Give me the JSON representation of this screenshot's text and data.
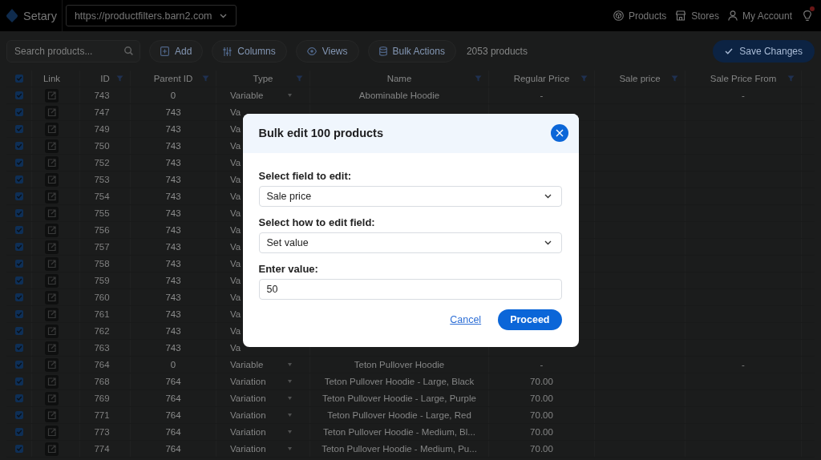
{
  "topbar": {
    "app_name": "Setary",
    "site_selector": "https://productfilters.barn2.com",
    "nav": [
      {
        "kind": "products",
        "label": "Products"
      },
      {
        "kind": "stores",
        "label": "Stores"
      },
      {
        "kind": "account",
        "label": "My Account"
      }
    ],
    "notification_dot": true
  },
  "toolbar": {
    "search": {
      "placeholder": "Search products..."
    },
    "buttons": [
      {
        "kind": "add",
        "label": "Add"
      },
      {
        "kind": "columns",
        "label": "Columns"
      },
      {
        "kind": "views",
        "label": "Views"
      },
      {
        "kind": "bulk",
        "label": "Bulk Actions"
      }
    ],
    "product_count": "2053 products",
    "save_button": "Save Changes"
  },
  "table": {
    "select_all": {
      "checked": true
    },
    "columns": [
      {
        "label": "Link",
        "filter": false
      },
      {
        "label": "ID",
        "filter": true
      },
      {
        "label": "Parent ID",
        "filter": true
      },
      {
        "label": "Type",
        "filter": true
      },
      {
        "label": "Name",
        "filter": true
      },
      {
        "label": "Regular Price",
        "filter": true
      },
      {
        "label": "Sale price",
        "filter": true
      },
      {
        "label": "Sale Price From",
        "filter": true
      }
    ],
    "rows": [
      {
        "checked": true,
        "id": "743",
        "parent_id": "0",
        "type": "Variable",
        "name": "Abominable Hoodie",
        "regular_price": "-",
        "sale_price_from": "-"
      },
      {
        "checked": true,
        "id": "747",
        "parent_id": "743",
        "type": "Va"
      },
      {
        "checked": true,
        "id": "749",
        "parent_id": "743",
        "type": "Va"
      },
      {
        "checked": true,
        "id": "750",
        "parent_id": "743",
        "type": "Va"
      },
      {
        "checked": true,
        "id": "752",
        "parent_id": "743",
        "type": "Va"
      },
      {
        "checked": true,
        "id": "753",
        "parent_id": "743",
        "type": "Va"
      },
      {
        "checked": true,
        "id": "754",
        "parent_id": "743",
        "type": "Va"
      },
      {
        "checked": true,
        "id": "755",
        "parent_id": "743",
        "type": "Va"
      },
      {
        "checked": true,
        "id": "756",
        "parent_id": "743",
        "type": "Va"
      },
      {
        "checked": true,
        "id": "757",
        "parent_id": "743",
        "type": "Va"
      },
      {
        "checked": true,
        "id": "758",
        "parent_id": "743",
        "type": "Va"
      },
      {
        "checked": true,
        "id": "759",
        "parent_id": "743",
        "type": "Va"
      },
      {
        "checked": true,
        "id": "760",
        "parent_id": "743",
        "type": "Va"
      },
      {
        "checked": true,
        "id": "761",
        "parent_id": "743",
        "type": "Va"
      },
      {
        "checked": true,
        "id": "762",
        "parent_id": "743",
        "type": "Va"
      },
      {
        "checked": true,
        "id": "763",
        "parent_id": "743",
        "type": "Va"
      },
      {
        "checked": true,
        "id": "764",
        "parent_id": "0",
        "type": "Variable",
        "name": "Teton Pullover Hoodie",
        "regular_price": "-",
        "sale_price_from": "-"
      },
      {
        "checked": true,
        "id": "768",
        "parent_id": "764",
        "type": "Variation",
        "name": "Teton Pullover Hoodie - Large, Black",
        "regular_price": "70.00"
      },
      {
        "checked": true,
        "id": "769",
        "parent_id": "764",
        "type": "Variation",
        "name": "Teton Pullover Hoodie - Large, Purple",
        "regular_price": "70.00"
      },
      {
        "checked": true,
        "id": "771",
        "parent_id": "764",
        "type": "Variation",
        "name": "Teton Pullover Hoodie - Large, Red",
        "regular_price": "70.00"
      },
      {
        "checked": true,
        "id": "773",
        "parent_id": "764",
        "type": "Variation",
        "name": "Teton Pullover Hoodie - Medium, Bl...",
        "regular_price": "70.00"
      },
      {
        "checked": true,
        "id": "774",
        "parent_id": "764",
        "type": "Variation",
        "name": "Teton Pullover Hoodie - Medium, Pu...",
        "regular_price": "70.00"
      }
    ]
  },
  "modal": {
    "title": "Bulk edit 100 products",
    "fields": [
      {
        "kind": "select",
        "label": "Select field to edit:",
        "value": "Sale price"
      },
      {
        "kind": "select",
        "label": "Select how to edit field:",
        "value": "Set value"
      },
      {
        "kind": "input",
        "label": "Enter value:",
        "value": "50"
      }
    ],
    "cancel": "Cancel",
    "proceed": "Proceed"
  }
}
